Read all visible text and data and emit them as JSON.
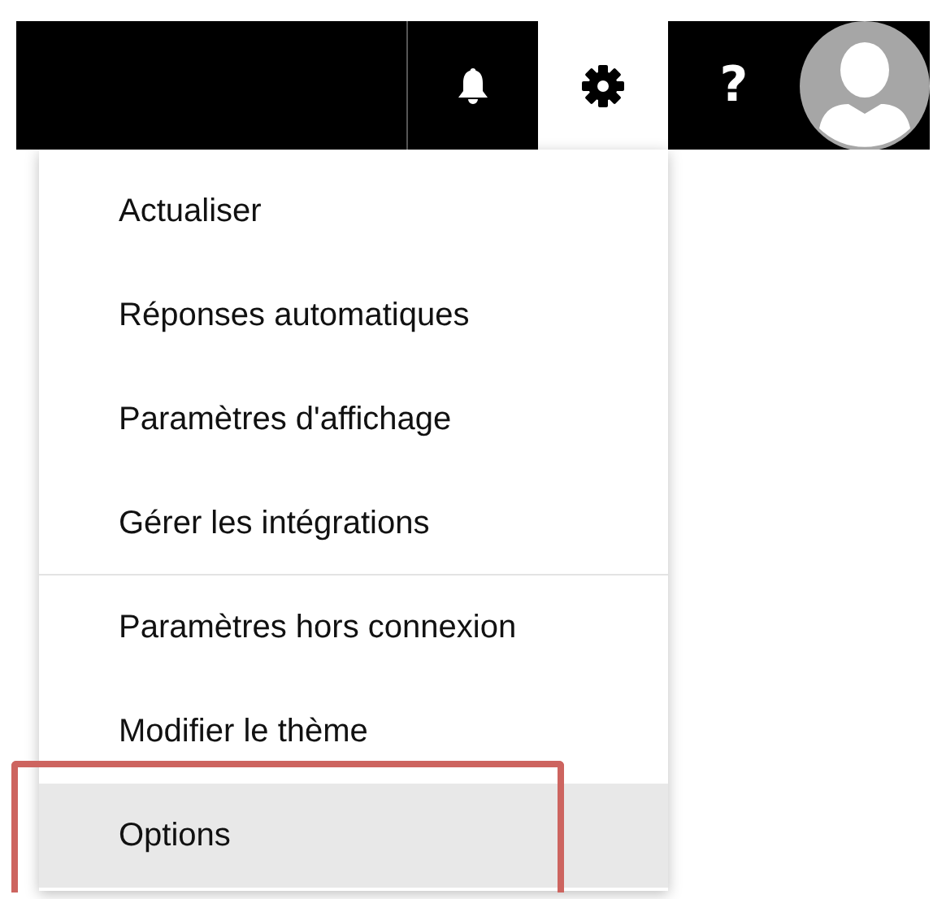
{
  "top_bar": {
    "buttons": [
      {
        "kind": "bell",
        "selected": false
      },
      {
        "kind": "gear",
        "selected": true
      },
      {
        "kind": "help",
        "label": "?",
        "selected": false
      }
    ],
    "avatar": {
      "kind": "silhouette"
    }
  },
  "menu": {
    "items": [
      {
        "label": "Actualiser",
        "selected": false,
        "annotated": false,
        "divider_after": false
      },
      {
        "label": "Réponses automatiques",
        "selected": false,
        "annotated": false,
        "divider_after": false
      },
      {
        "label": "Paramètres d'affichage",
        "selected": false,
        "annotated": false,
        "divider_after": false
      },
      {
        "label": "Gérer les intégrations",
        "selected": false,
        "annotated": false,
        "divider_after": true
      },
      {
        "label": "Paramètres hors connexion",
        "selected": false,
        "annotated": false,
        "divider_after": false
      },
      {
        "label": "Modifier le thème",
        "selected": false,
        "annotated": false,
        "divider_after": false
      },
      {
        "label": "Options",
        "selected": true,
        "annotated": true,
        "divider_after": false
      }
    ]
  }
}
